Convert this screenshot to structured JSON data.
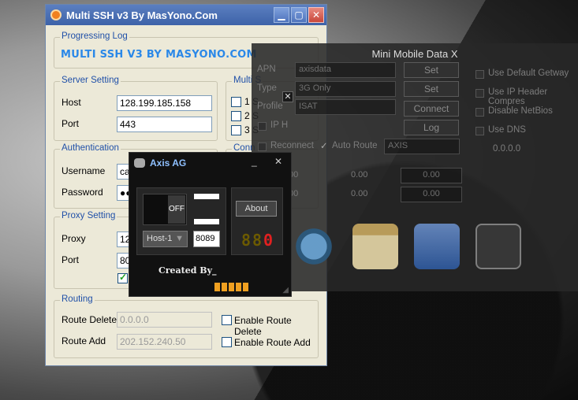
{
  "ssh": {
    "title": "Multi SSH v3 By MasYono.Com",
    "log_group": "Progressing Log",
    "log_text": "MULTI SSH V3 BY MASYONO.COM",
    "server_group": "Server Setting",
    "host_label": "Host",
    "host_value": "128.199.185.158",
    "port_label": "Port",
    "port_value": "443",
    "multi_group": "Multi S",
    "multi_items": [
      "1 S",
      "2 S",
      "3 S"
    ],
    "connect_group": "Conn",
    "auth_group": "Authentication",
    "username_label": "Username",
    "username_value": "ca",
    "password_label": "Password",
    "password_value": "●●",
    "proxy_group": "Proxy Setting",
    "proxy_label": "Proxy",
    "proxy_value": "12",
    "proxy_port_label": "Port",
    "proxy_port_value": "80",
    "routing_group": "Routing",
    "route_delete_label": "Route Delete",
    "route_delete_value": "0.0.0.0",
    "route_add_label": "Route Add",
    "route_add_value": "202.152.240.50",
    "enable_route_delete": "Enable Route Delete",
    "enable_route_add": "Enable Route Add"
  },
  "mmdx": {
    "title": "Mini Mobile Data X",
    "apn_label": "APN",
    "apn_value": "axisdata",
    "type_label": "Type",
    "type_value": "3G Only",
    "profile_label": "Profile",
    "profile_value": "ISAT",
    "iph_label": "IP H",
    "set1": "Set",
    "set2": "Set",
    "connect": "Connect",
    "log": "Log",
    "opt_gateway": "Use Default Getway",
    "opt_ipheader": "Use IP Header Compres",
    "opt_netbios": "Disable NetBios",
    "opt_dns": "Use DNS",
    "dns_value": "0.0.0.0",
    "reconnect": "Reconnect",
    "auto_route": "Auto Route",
    "carrier": "AXIS",
    "stats": [
      "00",
      "0.00",
      "0.00",
      "00",
      "0.00",
      "0.00"
    ]
  },
  "axis": {
    "title": "Axis AG",
    "minimize": "_",
    "close": "✕",
    "toggle_label": "OFF",
    "host_select": "Host-1",
    "port_value": "8089",
    "about": "About",
    "counter_digits": [
      "8",
      "8",
      "0"
    ],
    "created_by": "Created By_",
    "accent": "#f0a020"
  }
}
